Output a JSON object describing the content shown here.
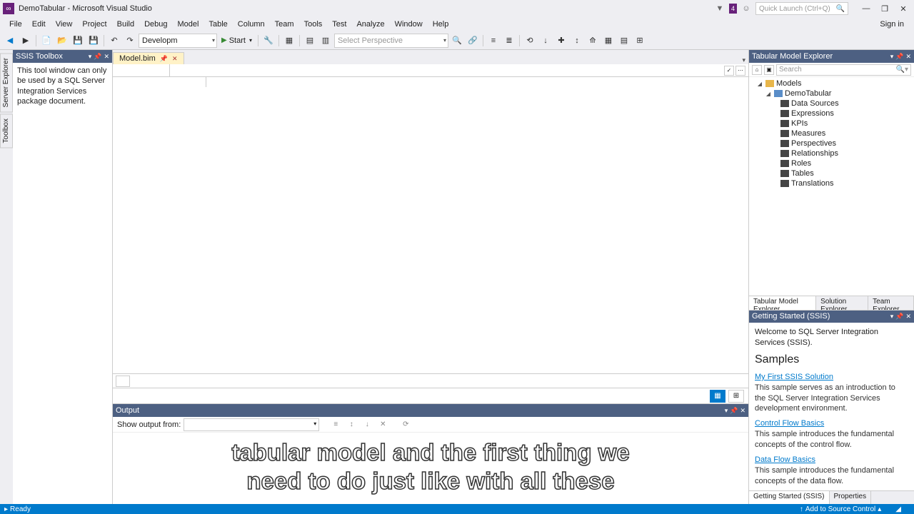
{
  "titlebar": {
    "title": "DemoTabular - Microsoft Visual Studio",
    "quick_launch_placeholder": "Quick Launch (Ctrl+Q)",
    "badge": "4"
  },
  "menubar": {
    "items": [
      "File",
      "Edit",
      "View",
      "Project",
      "Build",
      "Debug",
      "Model",
      "Table",
      "Column",
      "Team",
      "Tools",
      "Test",
      "Analyze",
      "Window",
      "Help"
    ],
    "signin": "Sign in"
  },
  "toolbar": {
    "config": "Developm",
    "start": "Start",
    "perspective_placeholder": "Select Perspective"
  },
  "left_panel": {
    "title": "SSIS Toolbox",
    "message": "This tool window can only be used by a SQL Server Integration Services package document."
  },
  "vtabs": [
    "Server Explorer",
    "Toolbox"
  ],
  "doc_tab": {
    "label": "Model.bim"
  },
  "explorer": {
    "title": "Tabular Model Explorer",
    "search_placeholder": "Search",
    "root": "Models",
    "model": "DemoTabular",
    "nodes": [
      "Data Sources",
      "Expressions",
      "KPIs",
      "Measures",
      "Perspectives",
      "Relationships",
      "Roles",
      "Tables",
      "Translations"
    ],
    "tabs": [
      "Tabular Model Explorer",
      "Solution Explorer",
      "Team Explorer"
    ]
  },
  "getting_started": {
    "title": "Getting Started (SSIS)",
    "welcome": "Welcome to SQL Server Integration Services (SSIS).",
    "samples_heading": "Samples",
    "samples": [
      {
        "link": "My First SSIS Solution",
        "desc": "This sample serves as an introduction to the SQL Server Integration Services development environment."
      },
      {
        "link": "Control Flow Basics",
        "desc": "This sample introduces the fundamental concepts of the control flow."
      },
      {
        "link": "Data Flow Basics",
        "desc": "This sample introduces the fundamental concepts of the data flow."
      }
    ],
    "tabs": [
      "Getting Started (SSIS)",
      "Properties"
    ]
  },
  "output": {
    "title": "Output",
    "show_label": "Show output from:"
  },
  "subtitle": {
    "line1": "tabular model and the first thing we",
    "line2": "need to do just like with all these"
  },
  "statusbar": {
    "ready": "Ready",
    "add_source": "Add to Source Control"
  }
}
